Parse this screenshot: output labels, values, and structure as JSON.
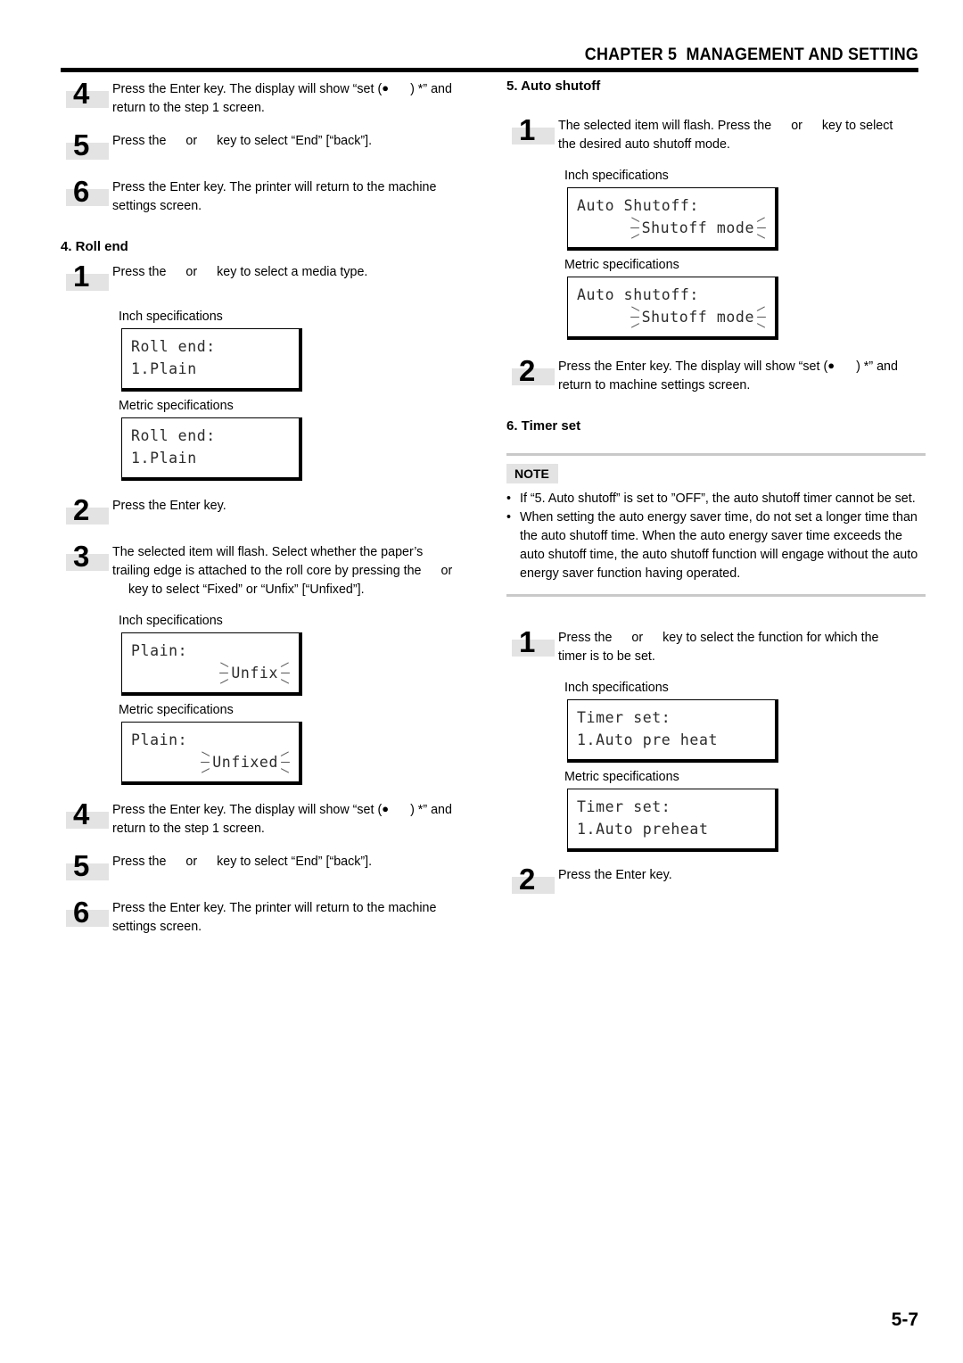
{
  "header": {
    "title": "CHAPTER 5  MANAGEMENT AND SETTING"
  },
  "page_number": "5-7",
  "labels": {
    "inch": "Inch specifications",
    "metric": "Metric specifications",
    "note_tag": "NOTE"
  },
  "left_column": {
    "steps_top": [
      {
        "number": "4",
        "line1_a": "Press the Enter key. The display will show “set (",
        "line1_dot": "●",
        "line1_b": ") *” and",
        "line2": "return to the step 1 screen."
      },
      {
        "number": "5",
        "line1_a": "Press the",
        "line1_b": "or",
        "line1_c": "key to select “End” [“back”]."
      },
      {
        "number": "6",
        "line1": "Press the Enter key. The printer will return to the machine",
        "line2": "settings screen."
      }
    ],
    "section": "4. Roll end",
    "step1": {
      "number": "1",
      "line1_a": "Press the",
      "line1_b": "or",
      "line1_c": "key to select a media type."
    },
    "lcd_roll_end_inch": {
      "line1": "Roll end:",
      "line2": "1.Plain"
    },
    "lcd_roll_end_metric": {
      "line1": "Roll end:",
      "line2": "1.Plain"
    },
    "step2": {
      "number": "2",
      "line1": "Press the Enter key."
    },
    "step3": {
      "number": "3",
      "line1": "The selected item will flash. Select whether the paper’s",
      "line2_a": "trailing edge is attached to the roll core by pressing the",
      "line2_b": "or",
      "line3": "key to select “Fixed” or “Unfix” [“Unfixed”]."
    },
    "lcd_plain_inch": {
      "line1": "Plain:",
      "value": "Unfix"
    },
    "lcd_plain_metric": {
      "line1": "Plain:",
      "value": "Unfixed"
    },
    "steps_bottom": [
      {
        "number": "4",
        "line1_a": "Press the Enter key. The display will show “set (",
        "line1_dot": "●",
        "line1_b": ") *” and",
        "line2": "return to the step 1 screen."
      },
      {
        "number": "5",
        "line1_a": "Press the",
        "line1_b": "or",
        "line1_c": "key to select “End” [“back”]."
      },
      {
        "number": "6",
        "line1": "Press the Enter key. The printer will return to the machine",
        "line2": "settings screen."
      }
    ]
  },
  "right_column": {
    "section_auto_shutoff": "5. Auto shutoff",
    "auto_step1": {
      "number": "1",
      "line1_a": "The selected item will flash. Press the",
      "line1_b": "or",
      "line1_c": "key to select",
      "line2": "the desired auto shutoff mode."
    },
    "lcd_auto_inch": {
      "line1": "Auto Shutoff:",
      "value": "Shutoff mode"
    },
    "lcd_auto_metric": {
      "line1": "Auto shutoff:",
      "value": "Shutoff mode"
    },
    "auto_step2": {
      "number": "2",
      "line1_a": "Press the Enter key. The display will show “set (",
      "line1_dot": "●",
      "line1_b": ") *” and",
      "line2": "return to machine settings screen."
    },
    "section_timer_set": "6. Timer set",
    "note_items": [
      "If “5. Auto shutoff” is set to ”OFF”, the auto shutoff timer cannot be set.",
      "When setting the auto energy saver time, do not set a longer time than the auto shutoff time. When the auto energy saver time exceeds the auto shutoff time, the auto shutoff function will engage without the auto energy saver function having operated."
    ],
    "timer_step1": {
      "number": "1",
      "line1_a": "Press the",
      "line1_b": "or",
      "line1_c": "key to select the function for which the",
      "line2": "timer is to be set."
    },
    "lcd_timer_inch": {
      "line1": "Timer set:",
      "line2": "1.Auto pre heat"
    },
    "lcd_timer_metric": {
      "line1": "Timer set:",
      "line2": "1.Auto preheat"
    },
    "timer_step2": {
      "number": "2",
      "line1": "Press the Enter key."
    }
  }
}
